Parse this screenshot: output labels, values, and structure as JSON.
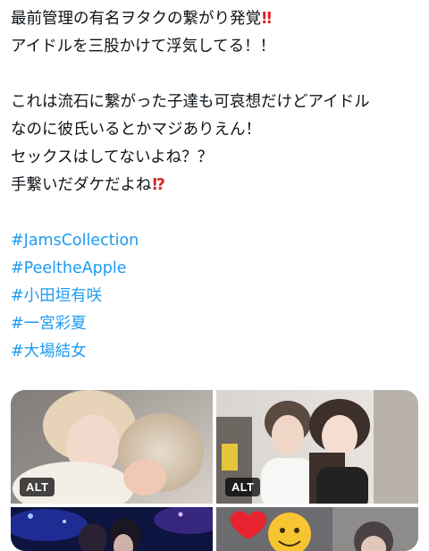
{
  "post": {
    "lines": [
      "最前管理の有名ヲタクの繋がり発覚",
      "アイドルを三股かけて浮気してる！！",
      "",
      "これは流石に繋がった子達も可哀想だけどアイドル",
      "なのに彼氏いるとかマジありえん！",
      "セックスはしてないよね？？",
      "手繋いだダケだよね"
    ],
    "line1_emoji": "‼",
    "line7_emoji": "⁉",
    "hashtags": [
      "#JamsCollection",
      "#PeeltheApple",
      "#小田垣有咲",
      "#一宮彩夏",
      "#大場結女"
    ]
  },
  "media": {
    "alt_label": "ALT",
    "tile_icons": [
      "photo-icon",
      "photo-icon",
      "photo-icon",
      "photo-icon"
    ]
  },
  "colors": {
    "text": "#0f1419",
    "hashtag": "#1d9bf0",
    "emoji_red": "#d8232a"
  }
}
